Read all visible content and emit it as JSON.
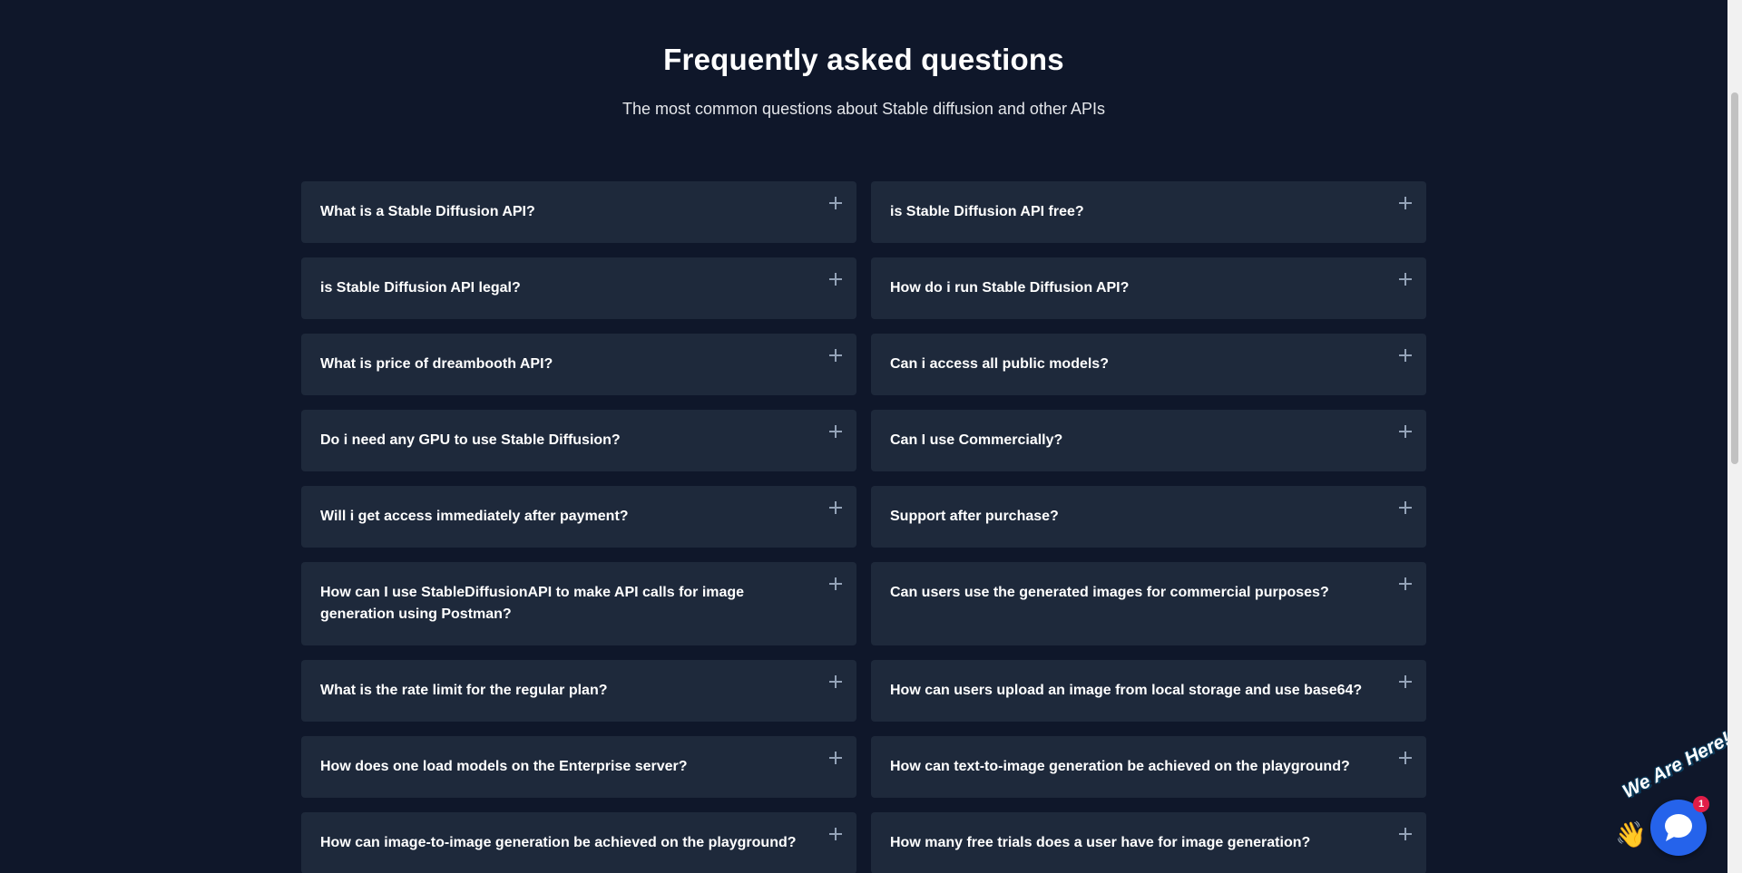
{
  "header": {
    "title": "Frequently asked questions",
    "subtitle": "The most common questions about Stable diffusion and other APIs"
  },
  "faqs": [
    {
      "question": "What is a Stable Diffusion API?"
    },
    {
      "question": "is Stable Diffusion API free?"
    },
    {
      "question": "is Stable Diffusion API legal?"
    },
    {
      "question": "How do i run Stable Diffusion API?"
    },
    {
      "question": "What is price of dreambooth API?"
    },
    {
      "question": "Can i access all public models?"
    },
    {
      "question": "Do i need any GPU to use Stable Diffusion?"
    },
    {
      "question": "Can I use Commercially?"
    },
    {
      "question": "Will i get access immediately after payment?"
    },
    {
      "question": "Support after purchase?"
    },
    {
      "question": "How can I use StableDiffusionAPI to make API calls for image generation using Postman?"
    },
    {
      "question": "Can users use the generated images for commercial purposes?"
    },
    {
      "question": "What is the rate limit for the regular plan?"
    },
    {
      "question": "How can users upload an image from local storage and use base64?"
    },
    {
      "question": "How does one load models on the Enterprise server?"
    },
    {
      "question": "How can text-to-image generation be achieved on the playground?"
    },
    {
      "question": "How can image-to-image generation be achieved on the playground?"
    },
    {
      "question": "How many free trials does a user have for image generation?"
    }
  ],
  "expand_icon": "plus-icon",
  "chat_widget": {
    "label": "We Are Here!",
    "badge_count": "1",
    "hand_glyph": "👋",
    "accent": "#2563eb",
    "badge_color": "#e11d48"
  },
  "colors": {
    "background": "#0f172a",
    "card": "#1e293b",
    "text": "#ffffff"
  }
}
